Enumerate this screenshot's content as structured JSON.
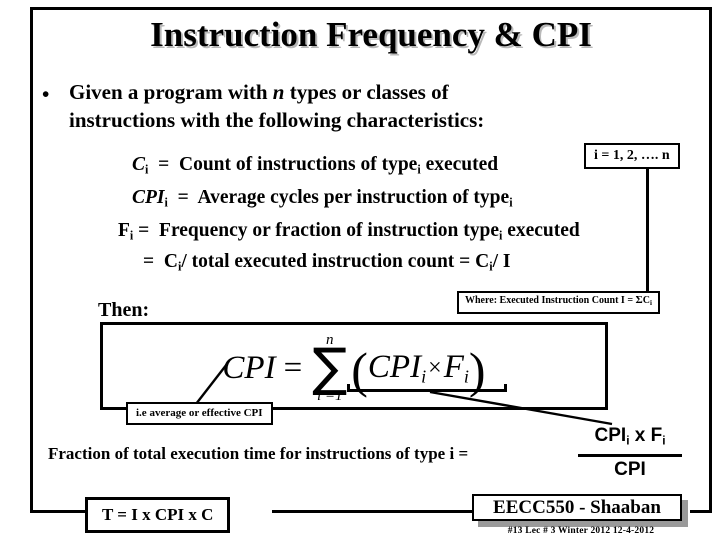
{
  "slide": {
    "title": "Instruction Frequency & CPI",
    "bullet": {
      "marker": "•",
      "line1_pre": "Given a program with ",
      "line1_italic": "n",
      "line1_post": " types or classes of",
      "line2": "instructions with the following characteristics:"
    },
    "definitions": [
      {
        "id": "count",
        "symbol": "C",
        "symbol_sub": "i",
        "equals": "=",
        "text_pre": "Count of instructions of type",
        "text_sub": "i",
        "text_post": " executed"
      },
      {
        "id": "cpi",
        "symbol": "CPI",
        "symbol_sub": "i",
        "equals": "=",
        "text_pre": "Average cycles per instruction of type",
        "text_sub": "i",
        "text_post": ""
      },
      {
        "id": "frequency",
        "symbol": "F",
        "symbol_sub": "i",
        "equals": "=",
        "text_pre": "Frequency or fraction of instruction type",
        "text_sub": "i",
        "text_post": " executed"
      },
      {
        "id": "frequency-alt",
        "symbol": "",
        "symbol_sub": "",
        "equals": "=",
        "text_pre": "C",
        "text_sub": "i",
        "text_post": "/ total executed instruction count = C",
        "text_sub2": "i",
        "text_post2": "/ I"
      }
    ],
    "callouts": {
      "i_range": "i = 1, 2, …. n",
      "where": {
        "prefix": "Where: Executed Instruction Count  I  =",
        "sigma": "Σ",
        "term": "C",
        "term_sub": "i"
      },
      "ie_average": "i.e average or effective CPI"
    },
    "then_label": "Then:",
    "formula": {
      "lhs": "CPI",
      "equals": "=",
      "sigma": "∑",
      "limit_top": "n",
      "limit_bottom": "i =1",
      "open_paren": "(",
      "term1": "CPI",
      "term1_sub": "i",
      "times": "×",
      "term2": "F",
      "term2_sub": "i",
      "close_paren": ")"
    },
    "fraction_statement": {
      "label": "Fraction of total execution time for instructions of type  i  =",
      "numerator_pre": "CPI",
      "numerator_sub": "i",
      "numerator_post": " x F",
      "numerator_sub2": "i",
      "denominator": "CPI"
    },
    "time_equation": "T =  I  x  CPI   x C",
    "footer": {
      "course": "EECC550 - Shaaban",
      "meta": "#13   Lec # 3    Winter 2012   12-4-2012"
    }
  },
  "colors": {
    "ink": "#000000",
    "paper": "#ffffff",
    "title_shadow": "#b9b9b9",
    "box_shadow": "#9a9a9a"
  }
}
